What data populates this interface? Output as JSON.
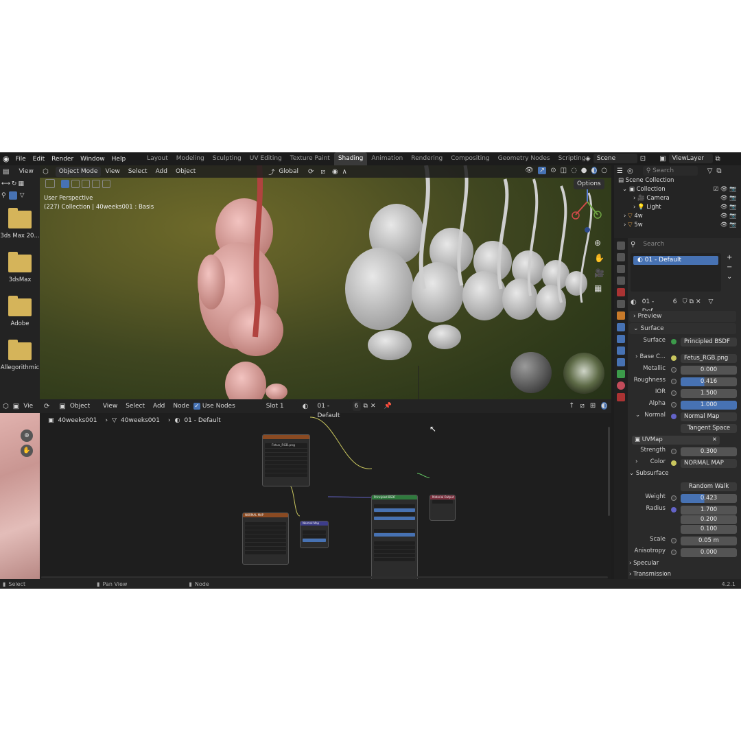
{
  "menu": [
    "File",
    "Edit",
    "Render",
    "Window",
    "Help"
  ],
  "workspaces": [
    "Layout",
    "Modeling",
    "Sculpting",
    "UV Editing",
    "Texture Paint",
    "Shading",
    "Animation",
    "Rendering",
    "Compositing",
    "Geometry Nodes",
    "Scripting"
  ],
  "active_workspace": "Shading",
  "add_workspace": "+",
  "scene": "Scene",
  "view_layer": "ViewLayer",
  "left_panel": {
    "view": "View",
    "folders": [
      "3ds Max 20...",
      "3dsMax",
      "Adobe",
      "Allegorithmic"
    ]
  },
  "viewport": {
    "mode": "Object Mode",
    "menus": [
      "View",
      "Select",
      "Add",
      "Object"
    ],
    "orientation": "Global",
    "options": "Options",
    "info_line1": "User Perspective",
    "info_line2": "(227) Collection | 40weeks001 : Basis"
  },
  "node_editor": {
    "left_view": "Vie",
    "type": "Object",
    "menus": [
      "View",
      "Select",
      "Add",
      "Node"
    ],
    "use_nodes": "Use Nodes",
    "slot": "Slot 1",
    "material": "01 - Default",
    "users": "6",
    "breadcrumb": [
      "40weeks001",
      "40weeks001",
      "01 - Default"
    ],
    "nodes": {
      "image_texture": "Fetus_RGB.png",
      "normal_tex": "NORMAL MAP",
      "normal_map": "Normal Map",
      "bsdf": "Principled BSDF",
      "output": "Material Output"
    }
  },
  "outliner": {
    "search": "Search",
    "items": [
      "Scene Collection",
      "Collection",
      "Camera",
      "Light",
      "4w",
      "5w"
    ]
  },
  "properties": {
    "search": "Search",
    "material_slot": "01 - Default",
    "material_name": "01 - Def...",
    "users": "6",
    "preview": "Preview",
    "surface_section": "Surface",
    "surface_label": "Surface",
    "surface_value": "Principled BSDF",
    "base_color_label": "Base C...",
    "base_color_value": "Fetus_RGB.png",
    "metallic_label": "Metallic",
    "metallic": "0.000",
    "roughness_label": "Roughness",
    "roughness": "0.416",
    "ior_label": "IOR",
    "ior": "1.500",
    "alpha_label": "Alpha",
    "alpha": "1.000",
    "normal_label": "Normal",
    "normal_value": "Normal Map",
    "tangent_space": "Tangent Space",
    "uvmap": "UVMap",
    "strength_label": "Strength",
    "strength": "0.300",
    "color_label": "Color",
    "color_value": "NORMAL MAP",
    "subsurface": "Subsurface",
    "random_walk": "Random Walk",
    "weight_label": "Weight",
    "weight": "0.423",
    "radius_label": "Radius",
    "radius": [
      "1.700",
      "0.200",
      "0.100"
    ],
    "scale_label": "Scale",
    "scale": "0.05 m",
    "anisotropy_label": "Anisotropy",
    "anisotropy": "0.000",
    "specular": "Specular",
    "transmission": "Transmission"
  },
  "status": {
    "select": "Select",
    "pan": "Pan View",
    "node": "Node",
    "version": "4.2.1"
  },
  "colors": {
    "accent_blue": "#4772b3",
    "folder": "#d5b45a",
    "background": "#1d1d1d"
  }
}
